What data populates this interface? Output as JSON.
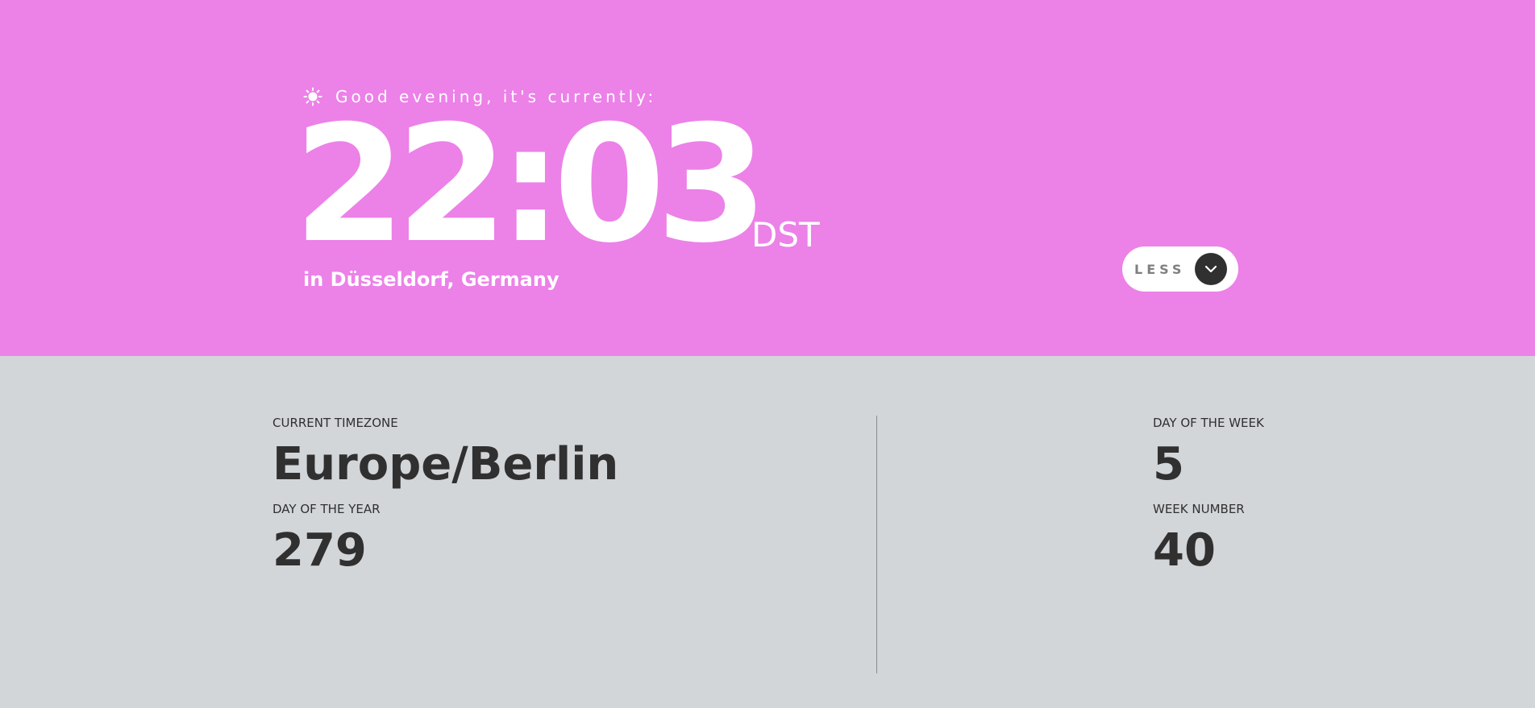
{
  "greeting": {
    "icon": "sun-icon",
    "text": "Good evening, it's currently:"
  },
  "clock": {
    "time": "22:03",
    "abbreviation": "DST"
  },
  "location": "in Düsseldorf, Germany",
  "toggle": {
    "label": "LESS",
    "icon": "chevron-down-icon"
  },
  "details": {
    "timezone": {
      "label": "CURRENT TIMEZONE",
      "value": "Europe/Berlin"
    },
    "day_of_year": {
      "label": "DAY OF THE YEAR",
      "value": "279"
    },
    "day_of_week": {
      "label": "DAY OF THE WEEK",
      "value": "5"
    },
    "week_number": {
      "label": "WEEK NUMBER",
      "value": "40"
    }
  },
  "colors": {
    "top_background": "#ec81e8",
    "bottom_background": "#d3d6d9",
    "text_dark": "#303030",
    "toggle_circle": "#303030",
    "toggle_label": "#7f7f7f"
  }
}
